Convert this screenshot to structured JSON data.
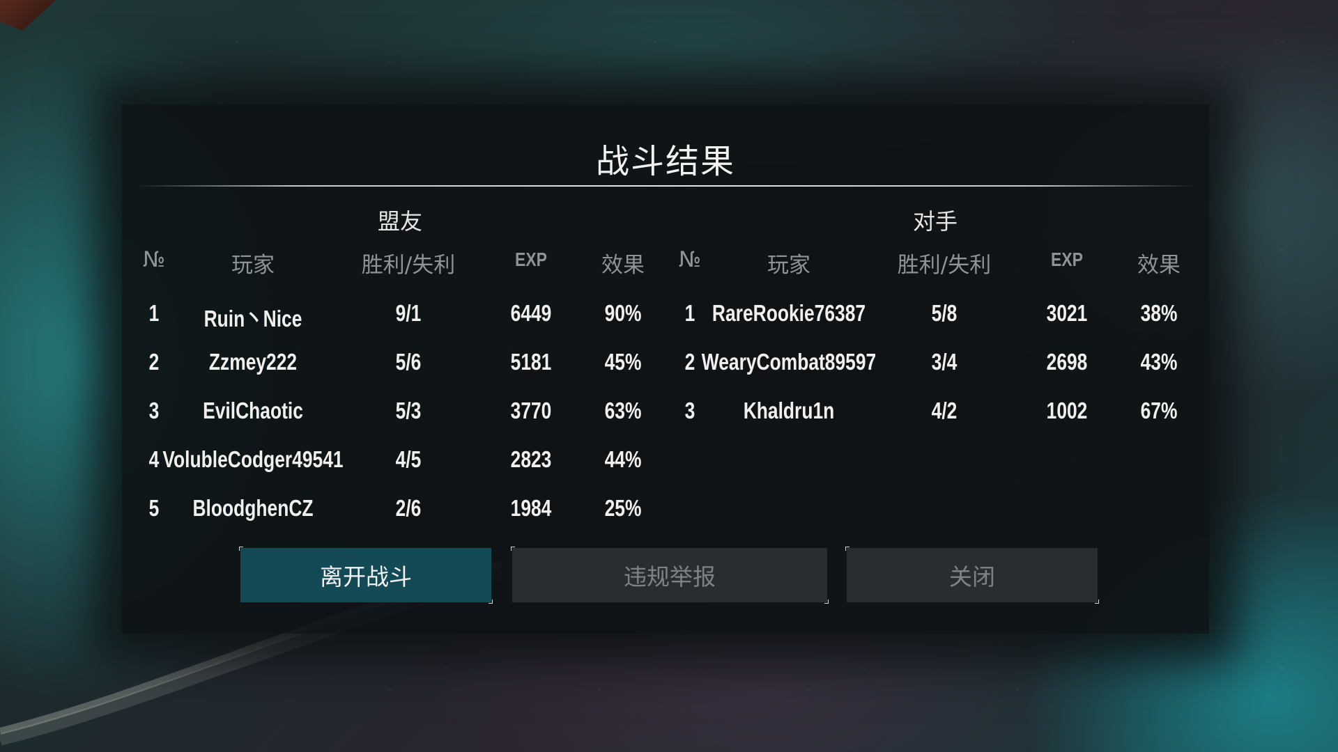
{
  "dialog": {
    "title": "战斗结果",
    "allies_label": "盟友",
    "enemies_label": "对手"
  },
  "columns": {
    "no": "№",
    "player": "玩家",
    "winloss": "胜利/失利",
    "exp": "EXP",
    "efficiency": "效果"
  },
  "allies": [
    {
      "no": "1",
      "player": "Ruin丶Nice",
      "winloss": "9/1",
      "exp": "6449",
      "efficiency": "90%"
    },
    {
      "no": "2",
      "player": "Zzmey222",
      "winloss": "5/6",
      "exp": "5181",
      "efficiency": "45%"
    },
    {
      "no": "3",
      "player": "EvilChaotic",
      "winloss": "5/3",
      "exp": "3770",
      "efficiency": "63%"
    },
    {
      "no": "4",
      "player": "VolubleCodger49541",
      "winloss": "4/5",
      "exp": "2823",
      "efficiency": "44%"
    },
    {
      "no": "5",
      "player": "BloodghenCZ",
      "winloss": "2/6",
      "exp": "1984",
      "efficiency": "25%"
    }
  ],
  "enemies": [
    {
      "no": "1",
      "player": "RareRookie76387",
      "winloss": "5/8",
      "exp": "3021",
      "efficiency": "38%"
    },
    {
      "no": "2",
      "player": "WearyCombat89597",
      "winloss": "3/4",
      "exp": "2698",
      "efficiency": "43%"
    },
    {
      "no": "3",
      "player": "Khaldru1n",
      "winloss": "4/2",
      "exp": "1002",
      "efficiency": "67%"
    }
  ],
  "buttons": {
    "leave": "离开战斗",
    "report": "违规举报",
    "close": "关闭"
  },
  "colors": {
    "primary_button": "#134a55",
    "secondary_button": "#2a2d2f",
    "header_text": "#8d9396"
  }
}
